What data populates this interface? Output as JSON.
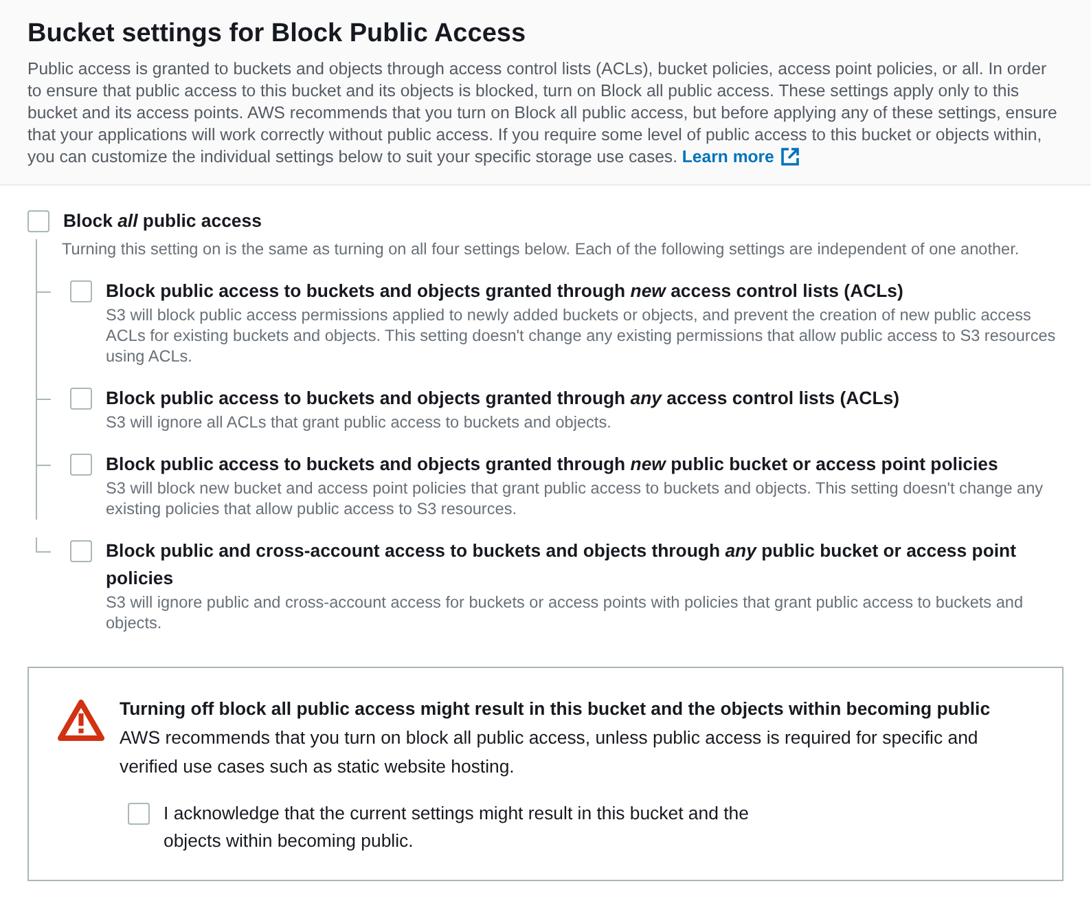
{
  "header": {
    "title": "Bucket settings for Block Public Access",
    "description": "Public access is granted to buckets and objects through access control lists (ACLs), bucket policies, access point policies, or all. In order to ensure that public access to this bucket and its objects is blocked, turn on Block all public access. These settings apply only to this bucket and its access points. AWS recommends that you turn on Block all public access, but before applying any of these settings, ensure that your applications will work correctly without public access. If you require some level of public access to this bucket or objects within, you can customize the individual settings below to suit your specific storage use cases.",
    "link": "Learn more"
  },
  "block_all": {
    "label": "Block *all* public access",
    "description": "Turning this setting on is the same as turning on all four settings below. Each of the following settings are independent of one another.",
    "checked": false
  },
  "settings": [
    {
      "label": "Block public access to buckets and objects granted through *new* access control lists (ACLs)",
      "description": "S3 will block public access permissions applied to newly added buckets or objects, and prevent the creation of new public access ACLs for existing buckets and objects. This setting doesn't change any existing permissions that allow public access to S3 resources using ACLs.",
      "checked": false
    },
    {
      "label": "Block public access to buckets and objects granted through *any* access control lists (ACLs)",
      "description": "S3 will ignore all ACLs that grant public access to buckets and objects.",
      "checked": false
    },
    {
      "label": "Block public access to buckets and objects granted through *new* public bucket or access point policies",
      "description": "S3 will block new bucket and access point policies that grant public access to buckets and objects. This setting doesn't change any existing policies that allow public access to S3 resources.",
      "checked": false
    },
    {
      "label": "Block public and cross-account access to buckets and objects through *any* public bucket or access point policies",
      "description": "S3 will ignore public and cross-account access for buckets or access points with policies that grant public access to buckets and objects.",
      "checked": false
    }
  ],
  "warning": {
    "title": "Turning off block all public access might result in this bucket and the objects within becoming public",
    "text": "AWS recommends that you turn on block all public access, unless public access is required for specific and verified use cases such as static website hosting.",
    "acknowledge": {
      "label": "I acknowledge that the current settings might result in this bucket and the objects within becoming public.",
      "checked": false
    }
  }
}
